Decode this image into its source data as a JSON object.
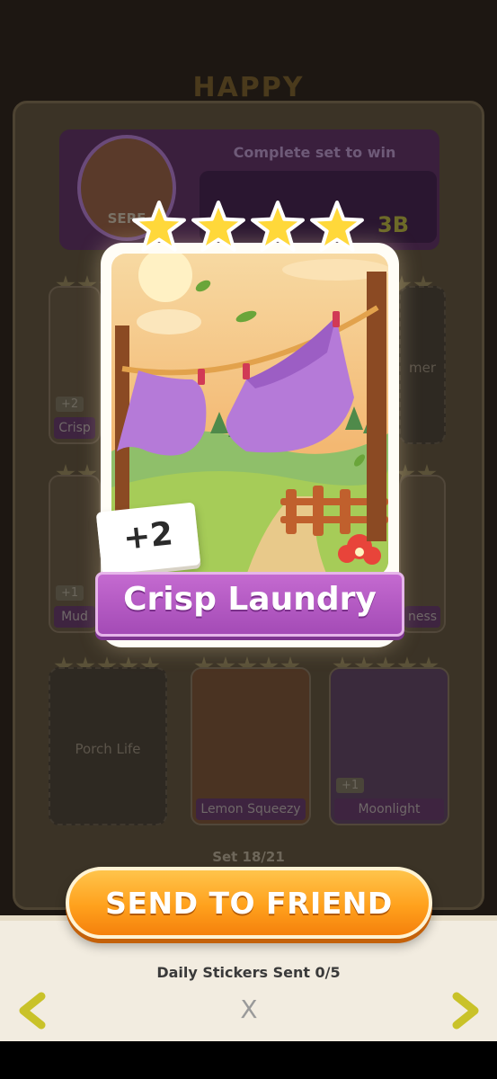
{
  "album": {
    "title": "HAPPY",
    "header": {
      "avatar_name": "SERE",
      "complete_text": "Complete set to win",
      "reward_amount": "3B"
    },
    "cards": [
      {
        "label": "Crisp",
        "count": "+2"
      },
      {
        "label": "mer",
        "count": ""
      },
      {
        "label": "Mud",
        "count": "+1"
      },
      {
        "label": "ness",
        "count": ""
      },
      {
        "label": "Porch Life",
        "count": "",
        "empty": true
      },
      {
        "label": "Lemon Squeezy",
        "count": ""
      },
      {
        "label": "Moonlight",
        "count": "+1"
      }
    ],
    "set_progress": "Set 18/21"
  },
  "sticker": {
    "name": "Crisp Laundry",
    "count": "+2",
    "stars": 4
  },
  "actions": {
    "send_label": "SEND TO FRIEND",
    "daily_sent": "Daily Stickers Sent 0/5",
    "close": "X"
  },
  "colors": {
    "accent_orange": "#ffa11d",
    "banner_purple": "#b155c3",
    "star_gold": "#ffd83a",
    "nav_arrow": "#c9c229"
  }
}
